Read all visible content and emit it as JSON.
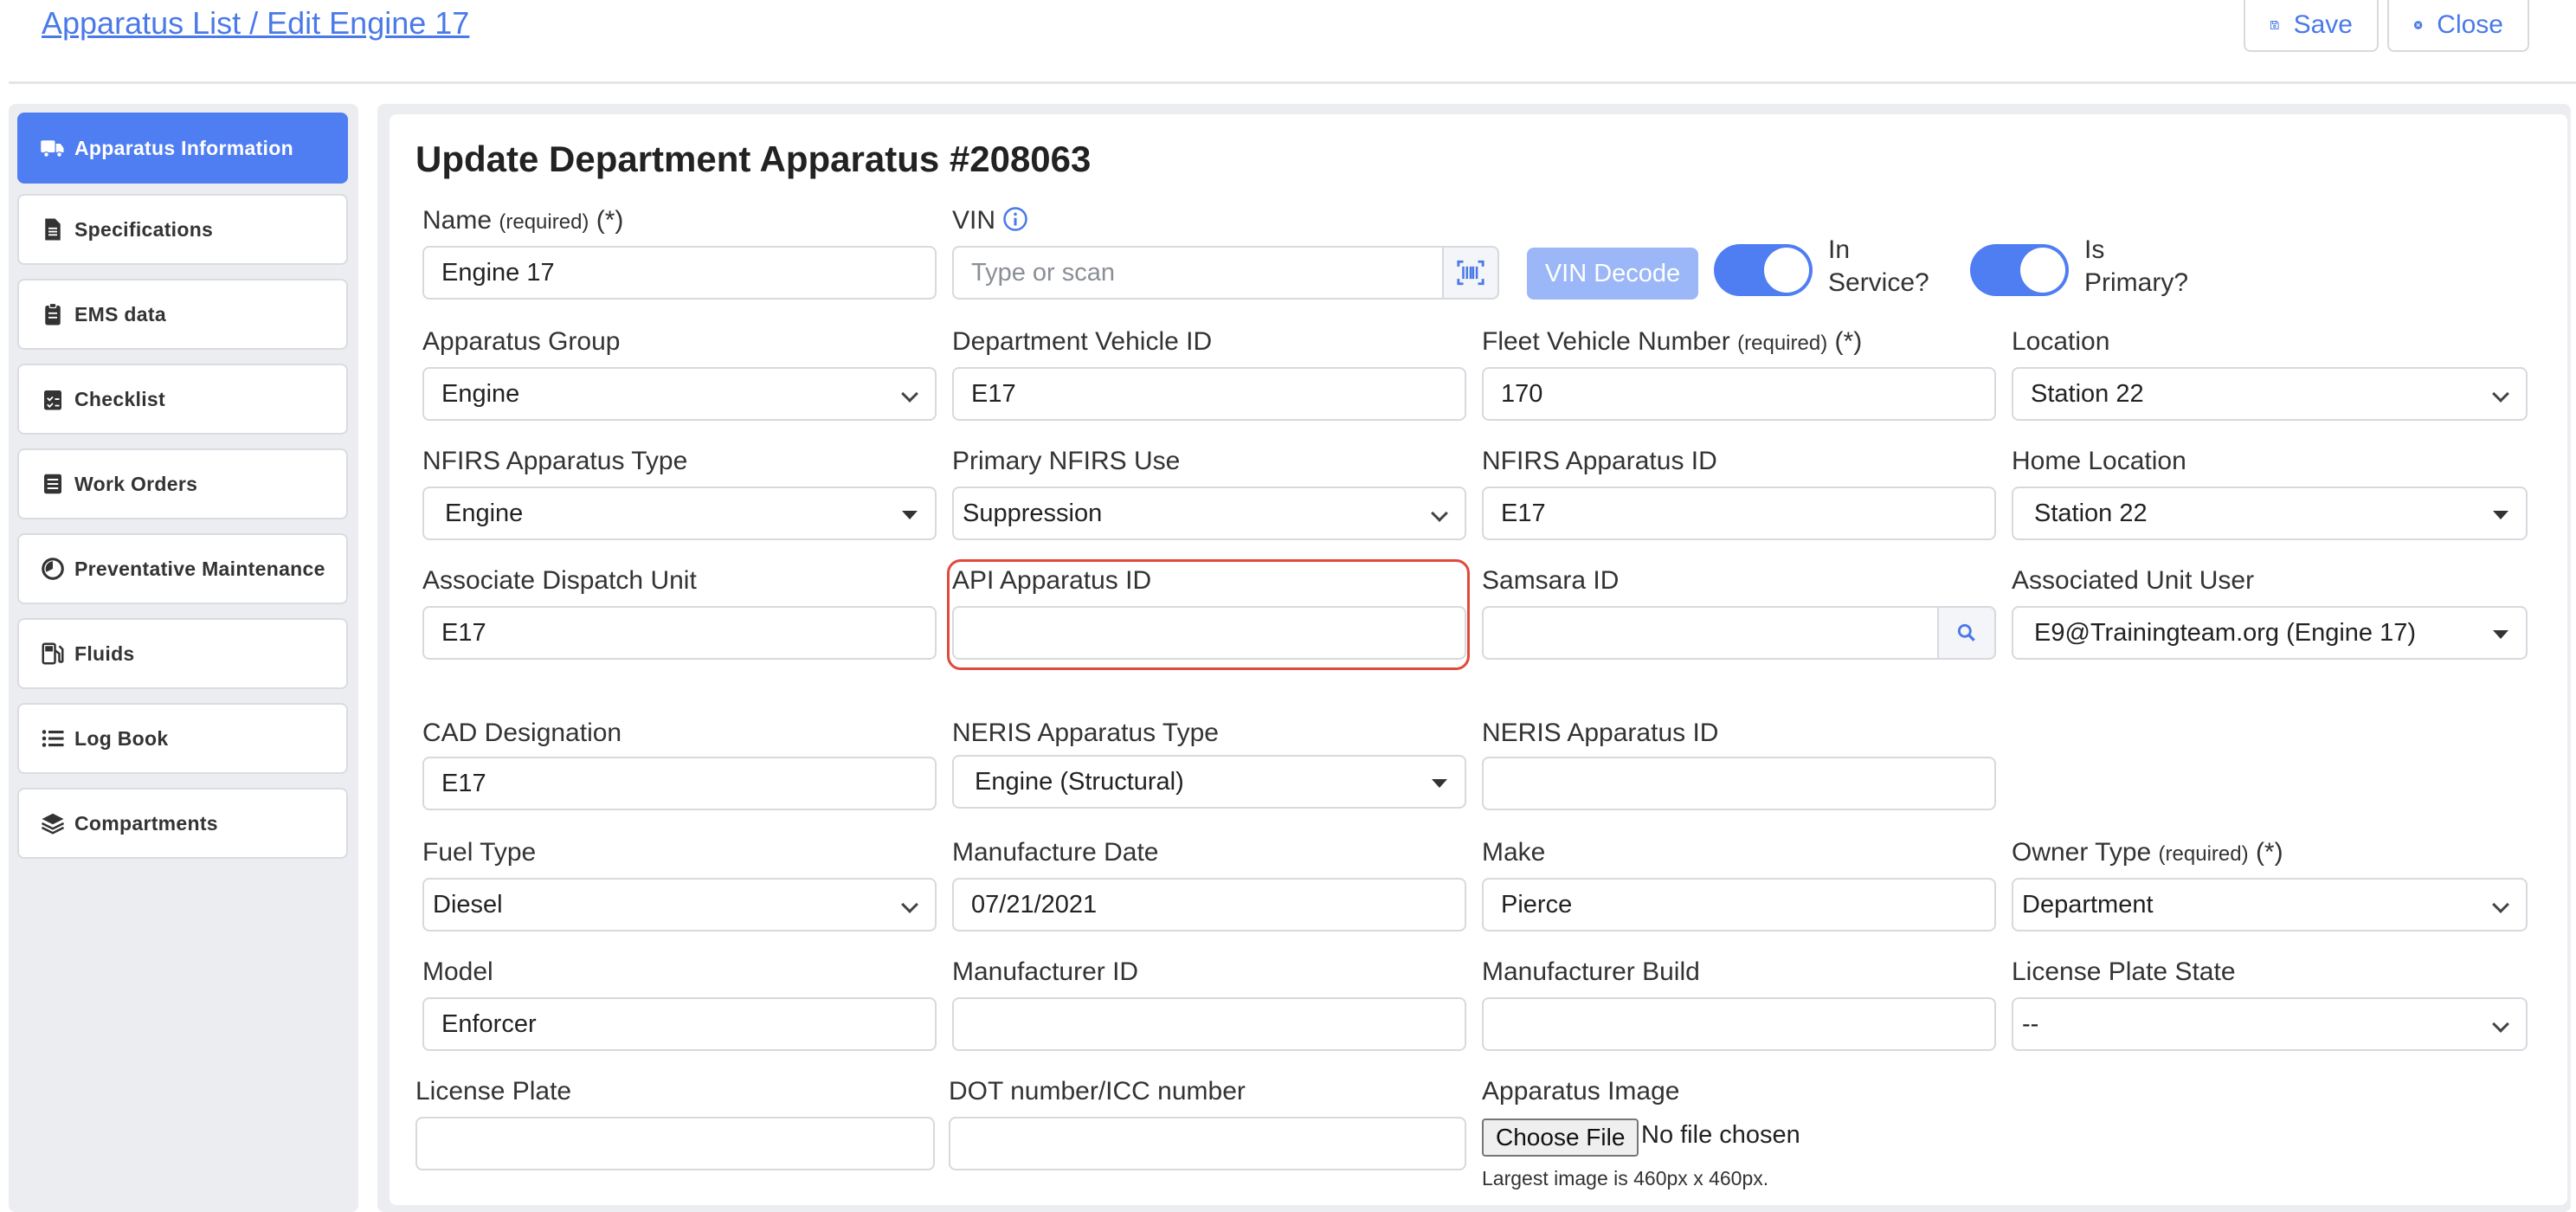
{
  "header": {
    "breadcrumb": "Apparatus List / Edit Engine 17",
    "save_label": "Save",
    "close_label": "Close"
  },
  "sidebar": {
    "items": [
      {
        "label": "Apparatus Information",
        "icon": "truck-icon",
        "active": true
      },
      {
        "label": "Specifications",
        "icon": "document-icon"
      },
      {
        "label": "EMS data",
        "icon": "clipboard-icon"
      },
      {
        "label": "Checklist",
        "icon": "checklist-icon"
      },
      {
        "label": "Work Orders",
        "icon": "list-box-icon"
      },
      {
        "label": "Preventative Maintenance",
        "icon": "gauge-icon"
      },
      {
        "label": "Fluids",
        "icon": "fuel-pump-icon"
      },
      {
        "label": "Log Book",
        "icon": "list-icon"
      },
      {
        "label": "Compartments",
        "icon": "layers-icon"
      }
    ]
  },
  "form": {
    "title": "Update Department Apparatus #208063",
    "required_text": "(required)",
    "required_mark": "(*)",
    "name": {
      "label": "Name",
      "value": "Engine 17"
    },
    "vin": {
      "label": "VIN",
      "placeholder": "Type or scan",
      "decode_label": "VIN Decode"
    },
    "in_service": {
      "line1": "In",
      "line2": "Service?",
      "on": true
    },
    "is_primary": {
      "line1": "Is",
      "line2": "Primary?",
      "on": true
    },
    "apparatus_group": {
      "label": "Apparatus Group",
      "value": "Engine"
    },
    "department_vehicle_id": {
      "label": "Department Vehicle ID",
      "value": "E17"
    },
    "fleet_vehicle_number": {
      "label": "Fleet Vehicle Number",
      "value": "170"
    },
    "location": {
      "label": "Location",
      "value": "Station 22"
    },
    "nfirs_apparatus_type": {
      "label": "NFIRS Apparatus Type",
      "value": "Engine"
    },
    "primary_nfirs_use": {
      "label": "Primary NFIRS Use",
      "value": "Suppression"
    },
    "nfirs_apparatus_id": {
      "label": "NFIRS Apparatus ID",
      "value": "E17"
    },
    "home_location": {
      "label": "Home Location",
      "value": "Station 22"
    },
    "associate_dispatch_unit": {
      "label": "Associate Dispatch Unit",
      "value": "E17"
    },
    "api_apparatus_id": {
      "label": "API Apparatus ID",
      "value": ""
    },
    "samsara_id": {
      "label": "Samsara ID",
      "value": ""
    },
    "associated_unit_user": {
      "label": "Associated Unit User",
      "value": "E9@Trainingteam.org (Engine 17)"
    },
    "cad_designation": {
      "label": "CAD Designation",
      "value": "E17"
    },
    "neris_apparatus_type": {
      "label": "NERIS Apparatus Type",
      "value": "Engine (Structural)"
    },
    "neris_apparatus_id": {
      "label": "NERIS Apparatus ID",
      "value": ""
    },
    "fuel_type": {
      "label": "Fuel Type",
      "value": "Diesel"
    },
    "manufacture_date": {
      "label": "Manufacture Date",
      "value": "07/21/2021"
    },
    "make": {
      "label": "Make",
      "value": "Pierce"
    },
    "owner_type": {
      "label": "Owner Type",
      "value": "Department"
    },
    "model": {
      "label": "Model",
      "value": "Enforcer"
    },
    "manufacturer_id": {
      "label": "Manufacturer ID",
      "value": ""
    },
    "manufacturer_build": {
      "label": "Manufacturer Build",
      "value": ""
    },
    "license_plate_state": {
      "label": "License Plate State",
      "value": "--"
    },
    "license_plate": {
      "label": "License Plate",
      "value": ""
    },
    "dot_number": {
      "label": "DOT number/ICC number",
      "value": ""
    },
    "apparatus_image": {
      "label": "Apparatus Image",
      "choose_label": "Choose File",
      "no_file": "No file chosen",
      "hint": "Largest image is 460px x 460px."
    }
  },
  "colors": {
    "accent": "#4f7df2",
    "link": "#4a79e8",
    "highlight": "#e04a3a"
  }
}
